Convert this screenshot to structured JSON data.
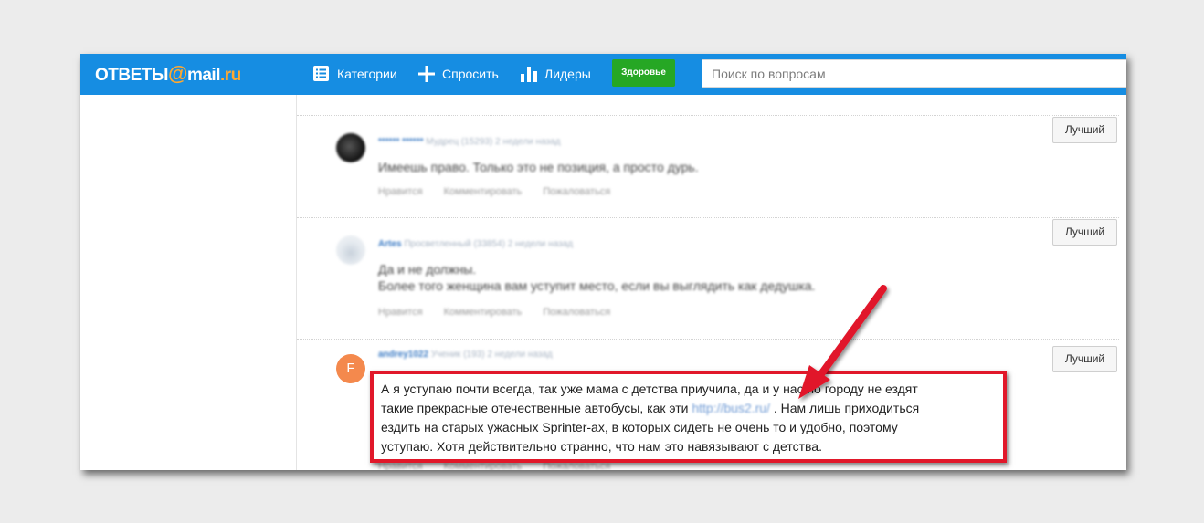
{
  "header": {
    "logo_part1": "ОТВЕТЫ",
    "logo_at": "@",
    "logo_part2": "mail",
    "logo_part3": ".ru",
    "nav": [
      {
        "label": "Категории",
        "icon": "list-icon"
      },
      {
        "label": "Спросить",
        "icon": "plus-icon"
      },
      {
        "label": "Лидеры",
        "icon": "bar-chart-icon"
      }
    ],
    "health_button": "Здоровье",
    "search_placeholder": "Поиск по вопросам"
  },
  "answers": [
    {
      "author": "****** ******",
      "status": "Мудрец (15293)",
      "time": "2 недели назад",
      "lines": [
        "Имеешь право. Только это не позиция, а просто дурь."
      ],
      "best_label": "Лучший",
      "actions": [
        "Нравится",
        "Комментировать",
        "Пожаловаться"
      ]
    },
    {
      "author": "Artes",
      "status": "Просветленный (33854)",
      "time": "2 недели назад",
      "lines": [
        "Да и не должны.",
        "Более того женщина вам уступит место, если вы выглядить как дедушка."
      ],
      "best_label": "Лучший",
      "actions": [
        "Нравится",
        "Комментировать",
        "Пожаловаться"
      ]
    },
    {
      "avatar_letter": "F",
      "author": "andrey1022",
      "status": "Ученик (193)",
      "time": "2 недели назад",
      "best_label": "Лучший",
      "actions": [
        "Нравится",
        "Комментировать",
        "Пожаловаться"
      ],
      "text": {
        "line1": "А я уступаю почти всегда, так уже мама с детства приучила, да и у нас по городу не ездят",
        "line2_before": "такие прекрасные отечественные автобусы, как эти ",
        "line2_link": "http://bus2.ru/",
        "line2_after": " . Нам лишь приходиться",
        "line3": "ездить на старых ужасных Sprinter-ах, в которых сидеть не очень то и удобно, поэтому",
        "line4": "уступаю. Хотя действительно странно, что нам это навязывают с детства."
      }
    }
  ],
  "colors": {
    "topbar": "#168de2",
    "logo_accent": "#ffa930",
    "health_button": "#26a724",
    "highlight_border": "#e1182a",
    "arrow": "#e1182a"
  }
}
